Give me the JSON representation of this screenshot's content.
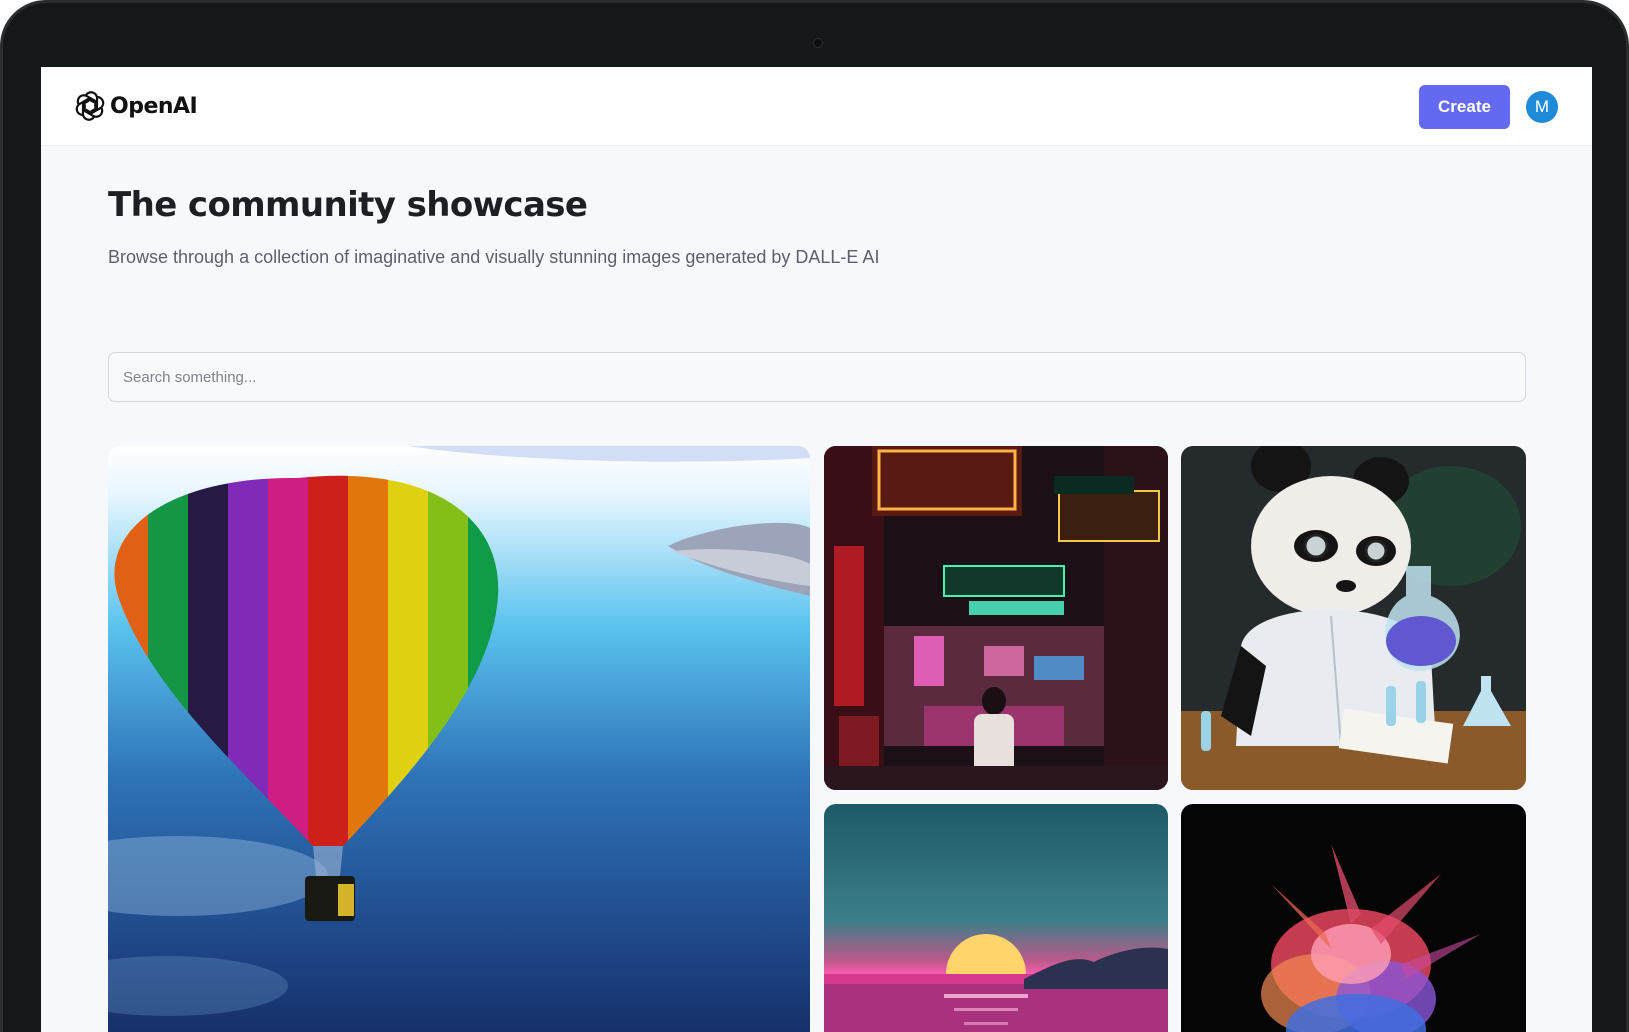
{
  "header": {
    "logo_text": "OpenAI",
    "create_label": "Create",
    "avatar_initial": "M"
  },
  "hero": {
    "title": "The community showcase",
    "subtitle": "Browse through a collection of imaginative and visually stunning images generated by DALL-E AI"
  },
  "search": {
    "placeholder": "Search something..."
  },
  "gallery": {
    "items": [
      {
        "subject": "rainbow hot air balloon"
      },
      {
        "subject": "neon city street"
      },
      {
        "subject": "panda scientist"
      },
      {
        "subject": "synthwave sunset"
      },
      {
        "subject": "color powder explosion"
      }
    ]
  },
  "colors": {
    "accent": "#6369f1",
    "avatar": "#1f8bd8",
    "page_bg": "#f7f8fc",
    "frame": "#151819"
  }
}
